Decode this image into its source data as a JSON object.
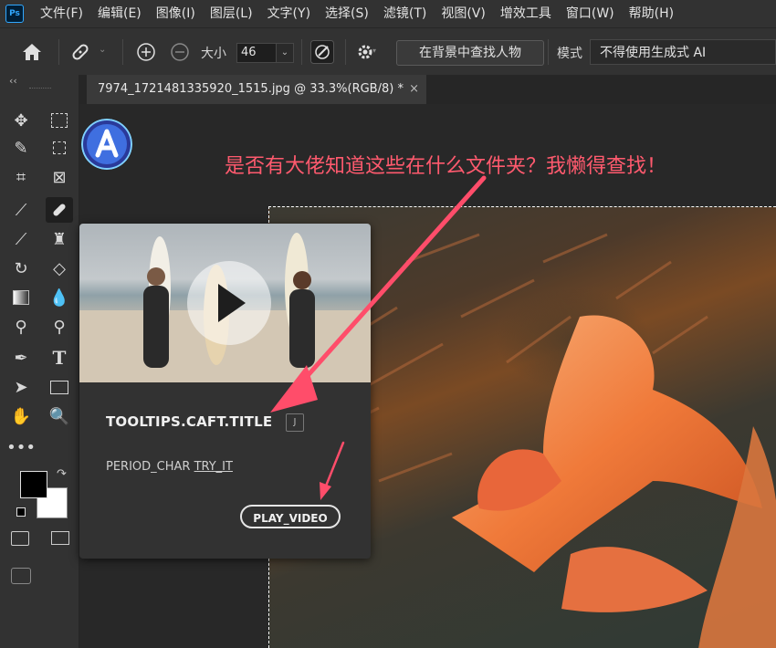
{
  "app": {
    "logo_text": "Ps"
  },
  "menu": [
    "文件(F)",
    "编辑(E)",
    "图像(I)",
    "图层(L)",
    "文字(Y)",
    "选择(S)",
    "滤镜(T)",
    "视图(V)",
    "增效工具",
    "窗口(W)",
    "帮助(H)"
  ],
  "options": {
    "size_label": "大小",
    "size_value": "46",
    "find_button": "在背景中查找人物",
    "mode_label": "模式",
    "mode_value": "不得使用生成式 AI"
  },
  "document": {
    "tab_title": "7974_1721481335920_1515.jpg @ 33.3%(RGB/8) *",
    "close_glyph": "×"
  },
  "annotation": {
    "text": "是否有大佬知道这些在什么文件夹？我懒得查找！",
    "color": "#ff5a6e"
  },
  "tooltip": {
    "title": "TOOLTIPS.CAFT.TITLE",
    "shortcut": "J",
    "desc_prefix": "PERIOD_CHAR",
    "try_link": "TRY_IT",
    "play_button": "PLAY_VIDEO"
  },
  "toolbar": {
    "collapse_glyph": "‹‹",
    "icons": [
      "move-icon",
      "marquee-icon",
      "quick-select-icon",
      "crop-select-icon",
      "crop-icon",
      "frame-icon",
      "eyedropper-icon",
      "spot-healing-icon",
      "brush-icon",
      "stamp-icon",
      "history-brush-icon",
      "eraser-icon",
      "gradient-icon",
      "blur-icon",
      "dodge-icon",
      "burn-icon",
      "pen-icon",
      "type-icon",
      "path-select-icon",
      "rectangle-icon",
      "hand-icon",
      "zoom-icon",
      "more-tools-icon"
    ]
  },
  "colors": {
    "accent": "#31a8ff",
    "annotation_arrow": "#ff4d6a",
    "foreground": "#000000",
    "background": "#ffffff"
  }
}
